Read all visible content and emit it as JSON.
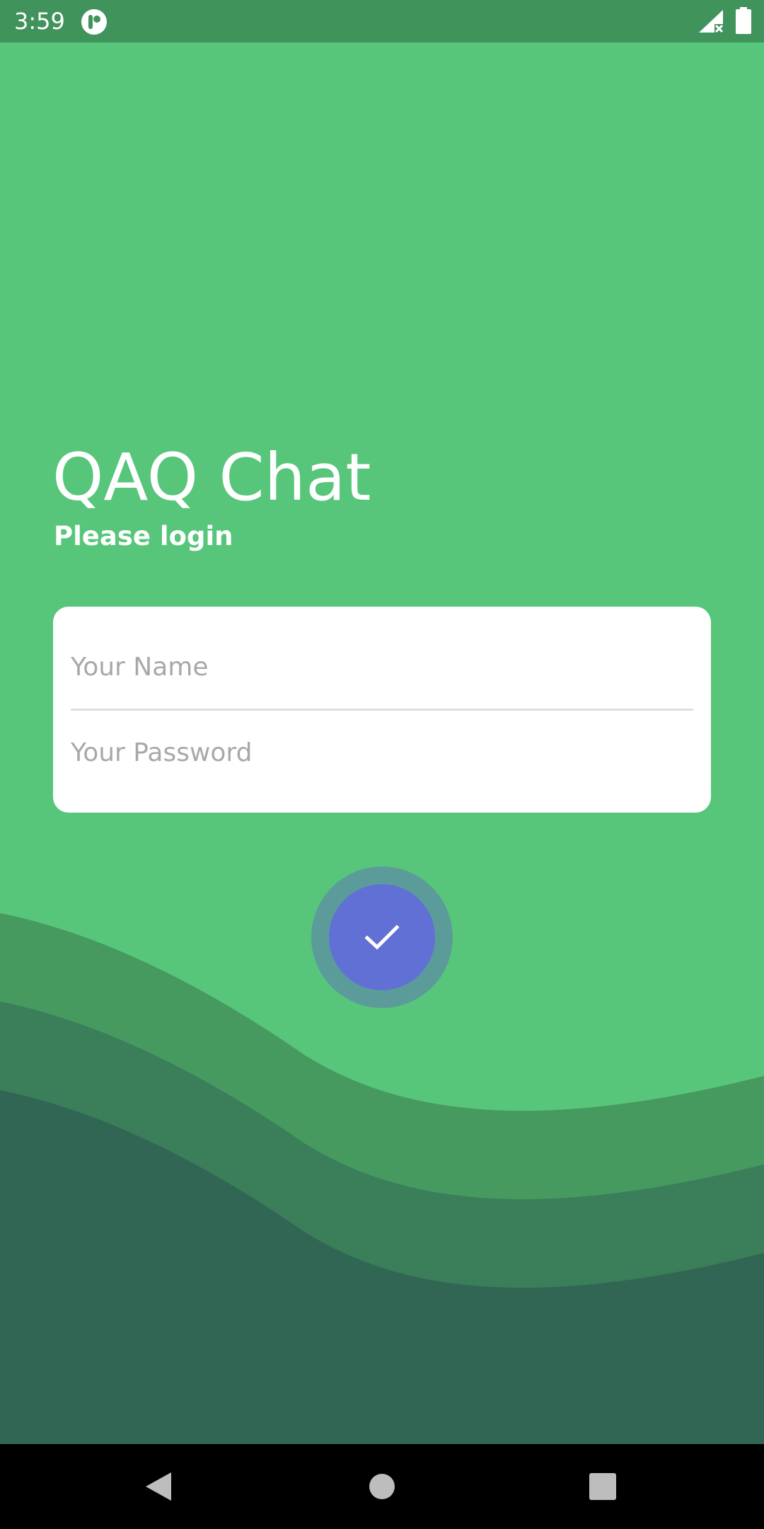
{
  "status_bar": {
    "time": "3:59",
    "icons": [
      "app-notification-icon",
      "signal-no-data-icon",
      "battery-full-icon"
    ]
  },
  "app": {
    "title": "QAQ Chat",
    "subtitle": "Please login"
  },
  "login_form": {
    "name_placeholder": "Your Name",
    "name_value": "",
    "password_placeholder": "Your Password",
    "password_value": ""
  },
  "submit": {
    "icon": "check-icon"
  },
  "nav_bar": {
    "buttons": [
      "back",
      "home",
      "recents"
    ]
  },
  "colors": {
    "background": "#57c67a",
    "status_bar": "#41935c",
    "wave_light": "#46995f",
    "wave_mid": "#3a7e5a",
    "wave_dark": "#326654",
    "submit_button": "#6170d4",
    "submit_ring": "#5b9c9b"
  }
}
